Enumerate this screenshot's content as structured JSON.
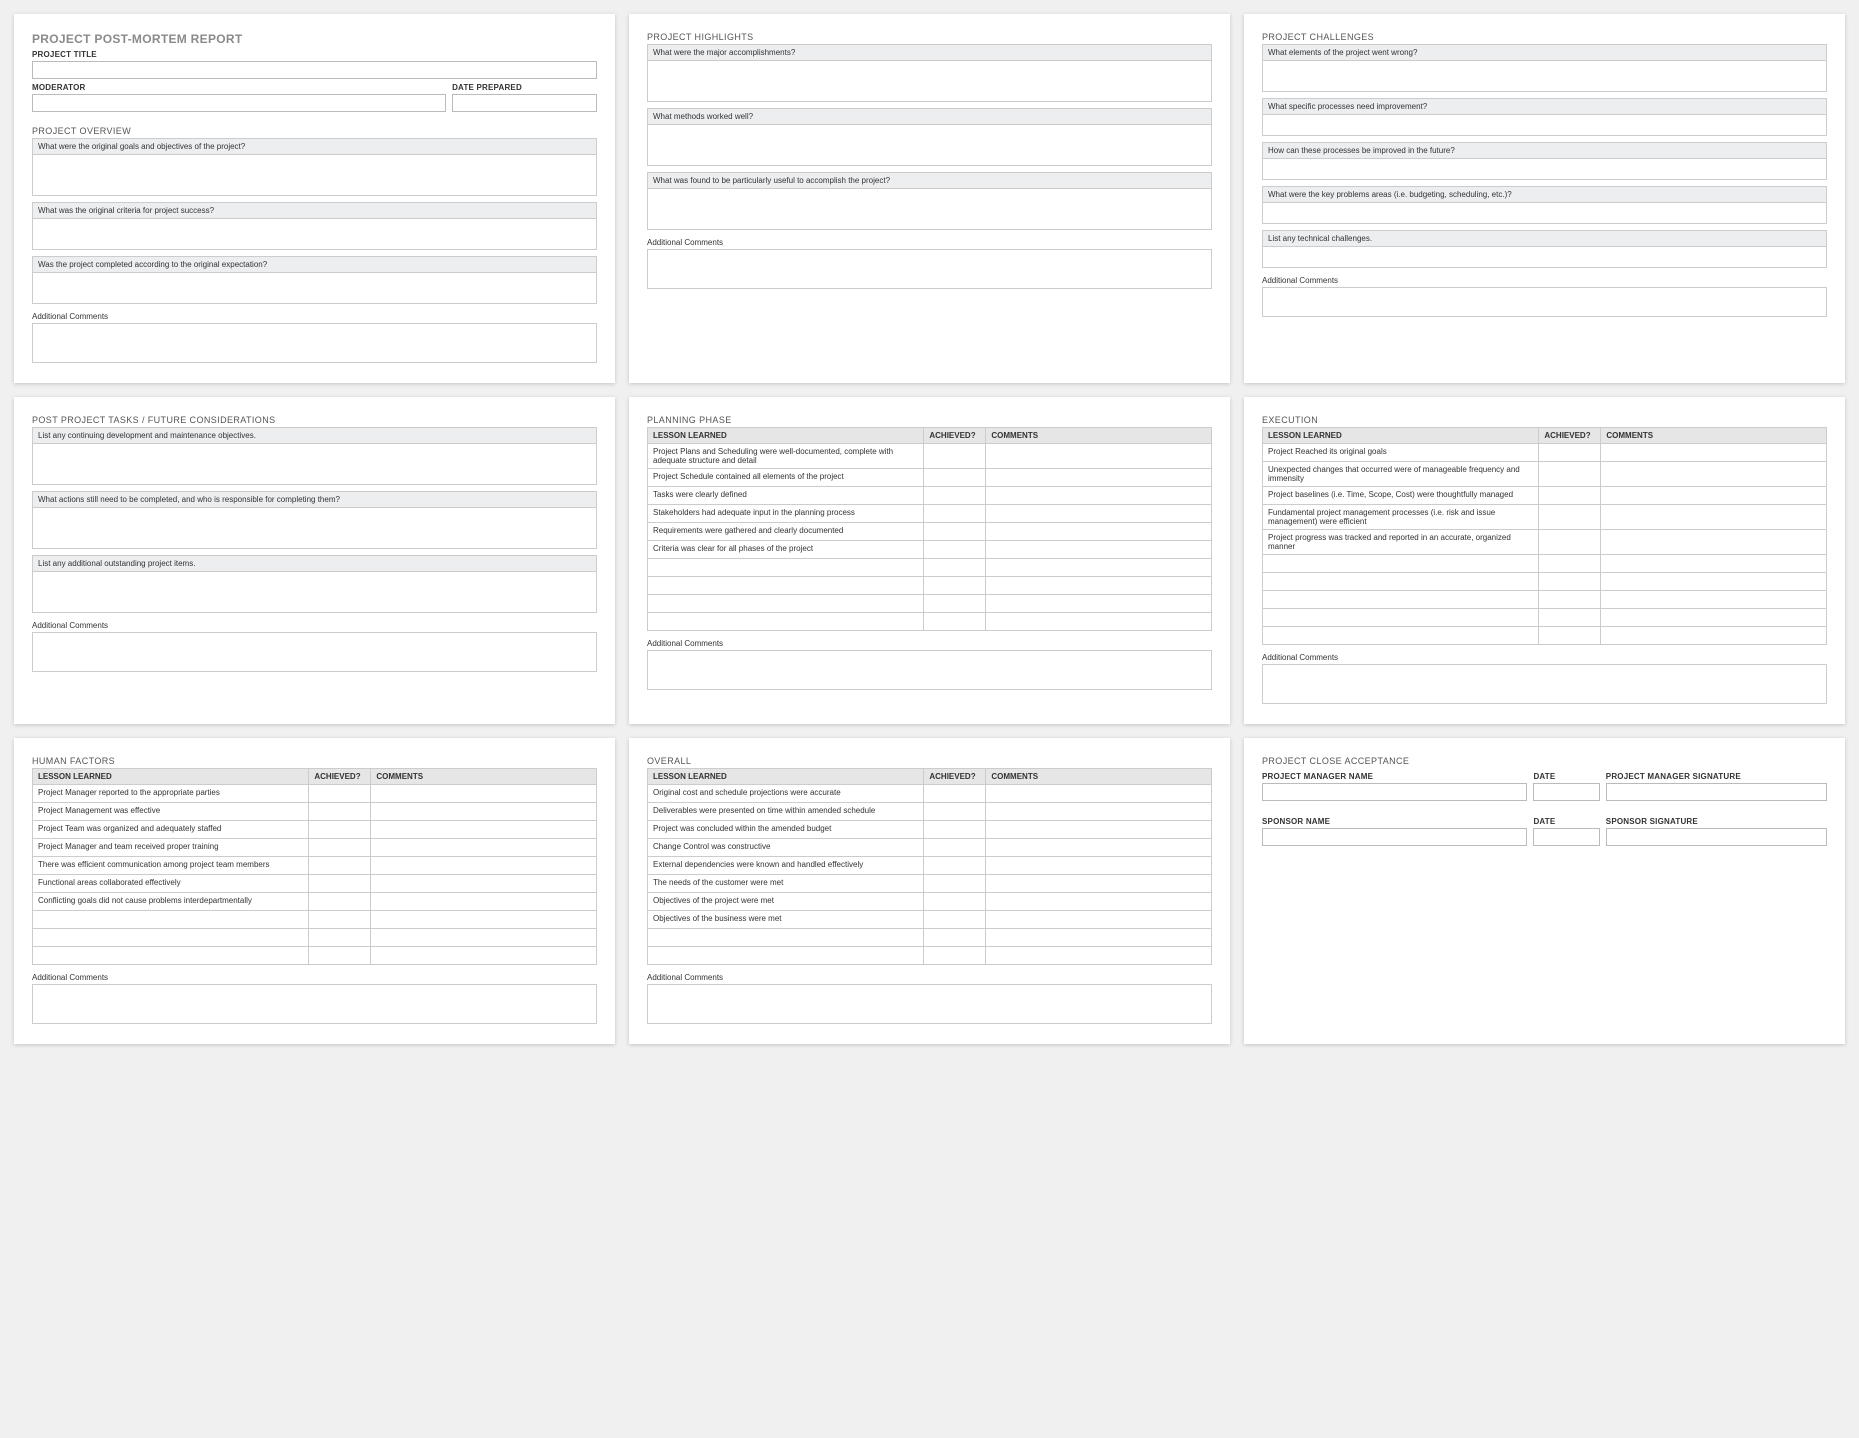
{
  "doc_title": "PROJECT POST-MORTEM REPORT",
  "labels": {
    "project_title": "PROJECT TITLE",
    "moderator": "MODERATOR",
    "date_prepared": "DATE PREPARED",
    "additional_comments": "Additional Comments"
  },
  "card1": {
    "overview_head": "PROJECT OVERVIEW",
    "q1": "What were the original goals and objectives of the project?",
    "q2": "What was the original criteria for project success?",
    "q3": "Was the project completed according to the original expectation?"
  },
  "card2": {
    "head": "PROJECT HIGHLIGHTS",
    "q1": "What were the major accomplishments?",
    "q2": "What methods worked well?",
    "q3": "What was found to be particularly useful to accomplish the project?"
  },
  "card3": {
    "head": "PROJECT CHALLENGES",
    "q1": "What elements of the project went wrong?",
    "q2": "What specific processes need improvement?",
    "q3": "How can these processes be improved in the future?",
    "q4": "What were the key problems areas (i.e. budgeting, scheduling, etc.)?",
    "q5": "List any technical challenges."
  },
  "card4": {
    "head": "POST PROJECT TASKS / FUTURE CONSIDERATIONS",
    "q1": "List any continuing development and maintenance objectives.",
    "q2": "What actions still need to be completed, and who is responsible for completing them?",
    "q3": "List any additional outstanding project items."
  },
  "table_headers": {
    "lesson": "LESSON LEARNED",
    "achieved": "ACHIEVED?",
    "comments": "COMMENTS"
  },
  "card5": {
    "head": "PLANNING PHASE",
    "rows": [
      "Project Plans and Scheduling were well-documented, complete with adequate structure and detail",
      "Project Schedule contained all elements of the project",
      "Tasks were clearly defined",
      "Stakeholders had adequate input in the planning process",
      "Requirements were gathered and clearly documented",
      "Criteria was clear for all phases of the project",
      "",
      "",
      "",
      ""
    ]
  },
  "card6": {
    "head": "EXECUTION",
    "rows": [
      "Project Reached its original goals",
      "Unexpected changes that occurred were of manageable frequency and immensity",
      "Project baselines (i.e. Time, Scope, Cost) were thoughtfully managed",
      "Fundamental project management processes (i.e. risk and issue management) were efficient",
      "Project progress was tracked and reported in an accurate, organized manner",
      "",
      "",
      "",
      "",
      ""
    ]
  },
  "card7": {
    "head": "HUMAN FACTORS",
    "rows": [
      "Project Manager reported to the appropriate parties",
      "Project Management was effective",
      "Project Team was organized and adequately staffed",
      "Project Manager and team received proper training",
      "There was efficient communication among project team members",
      "Functional areas collaborated effectively",
      "Conflicting goals did not cause problems interdepartmentally",
      "",
      "",
      ""
    ]
  },
  "card8": {
    "head": "OVERALL",
    "rows": [
      "Original cost and schedule projections were accurate",
      "Deliverables were presented on time within amended schedule",
      "Project was concluded within the amended budget",
      "Change Control was constructive",
      "External dependencies were known and handled effectively",
      "The needs of the customer were met",
      "Objectives of the project were met",
      "Objectives of the business were met",
      "",
      ""
    ]
  },
  "card9": {
    "head": "PROJECT CLOSE ACCEPTANCE",
    "pm_name": "PROJECT MANAGER NAME",
    "date": "DATE",
    "pm_sig": "PROJECT MANAGER SIGNATURE",
    "sponsor_name": "SPONSOR NAME",
    "sponsor_sig": "SPONSOR SIGNATURE"
  }
}
